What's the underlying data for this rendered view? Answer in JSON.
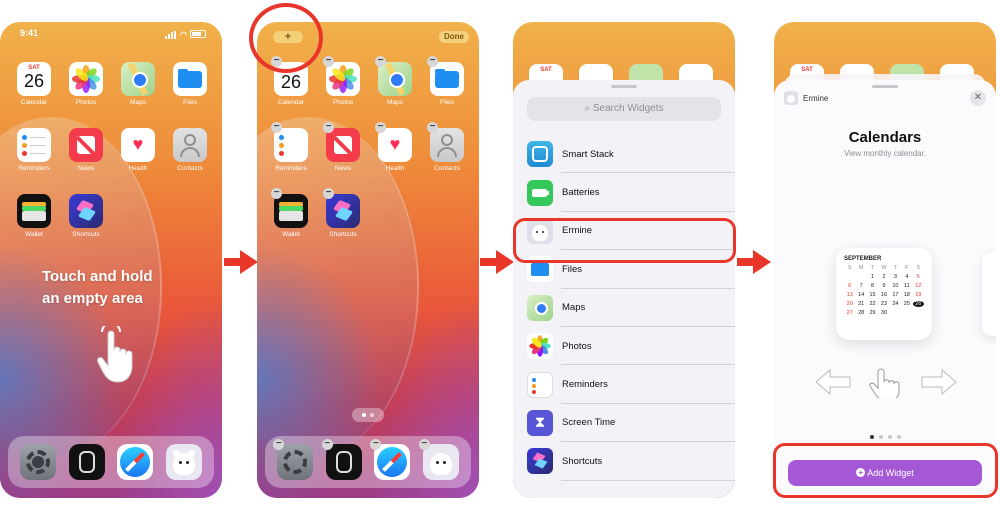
{
  "accent_red": "#e8362b",
  "panel1": {
    "time": "9:41",
    "calendar_weekday": "SAT",
    "calendar_day": "26",
    "apps": [
      "Calendar",
      "Photos",
      "Maps",
      "Files",
      "Reminders",
      "News",
      "Health",
      "Contacts",
      "Wallet",
      "Shortcuts"
    ],
    "instruction_line1": "Touch and hold",
    "instruction_line2": "an empty area",
    "dock_icons": [
      "settings-icon",
      "watch-icon",
      "safari-icon",
      "ermine-icon"
    ]
  },
  "panel2": {
    "add_button": "+",
    "done_button": "Done",
    "calendar_day": "26",
    "apps": [
      "Calendar",
      "Photos",
      "Maps",
      "Files",
      "Reminders",
      "News",
      "Health",
      "Contacts",
      "Wallet",
      "Shortcuts"
    ]
  },
  "panel3": {
    "calendar_weekday": "SAT",
    "search_placeholder": "Search Widgets",
    "widgets": [
      "Smart Stack",
      "Batteries",
      "Ermine",
      "Files",
      "Maps",
      "Photos",
      "Reminders",
      "Screen Time",
      "Shortcuts"
    ],
    "highlighted": "Ermine"
  },
  "panel4": {
    "calendar_weekday": "SAT",
    "app_name": "Ermine",
    "close": "✕",
    "title": "Calendars",
    "subtitle": "View monthly calendar.",
    "month": "SEPTEMBER",
    "weekdays": [
      "S",
      "M",
      "T",
      "W",
      "T",
      "F",
      "S"
    ],
    "dates": [
      [
        "",
        "",
        "1",
        "2",
        "3",
        "4",
        "5"
      ],
      [
        "6",
        "7",
        "8",
        "9",
        "10",
        "11",
        "12"
      ],
      [
        "13",
        "14",
        "15",
        "16",
        "17",
        "18",
        "19"
      ],
      [
        "20",
        "21",
        "22",
        "23",
        "24",
        "25",
        "26"
      ],
      [
        "27",
        "28",
        "29",
        "30",
        "",
        "",
        ""
      ]
    ],
    "today": "26",
    "add_widget_label": "Add Widget",
    "page_count": 4,
    "current_page": 1
  }
}
